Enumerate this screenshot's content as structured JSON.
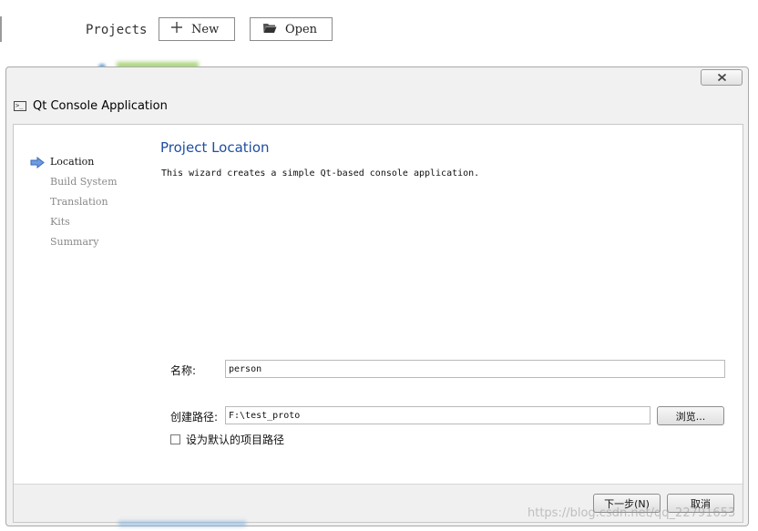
{
  "background": {
    "projects_label": "Projects",
    "new_label": "New",
    "open_label": "Open"
  },
  "dialog": {
    "title": "Qt Console Application",
    "close_glyph": "✕"
  },
  "wizard": {
    "steps": [
      {
        "label": "Location",
        "active": true
      },
      {
        "label": "Build System",
        "active": false
      },
      {
        "label": "Translation",
        "active": false
      },
      {
        "label": "Kits",
        "active": false
      },
      {
        "label": "Summary",
        "active": false
      }
    ],
    "heading": "Project Location",
    "description": "This wizard creates a simple Qt-based console application.",
    "name_label": "名称:",
    "name_value": "person",
    "path_label": "创建路径:",
    "path_value": "F:\\test_proto",
    "browse_label": "浏览...",
    "default_path_label": "设为默认的项目路径",
    "next_label": "下一步(N)",
    "cancel_label": "取消"
  },
  "watermark": "https://blog.csdn.net/qq_22791653",
  "colors": {
    "heading": "#1f4fa0",
    "active_arrow": "#4a7fd0",
    "dialog_bg": "#f1f1f1"
  }
}
